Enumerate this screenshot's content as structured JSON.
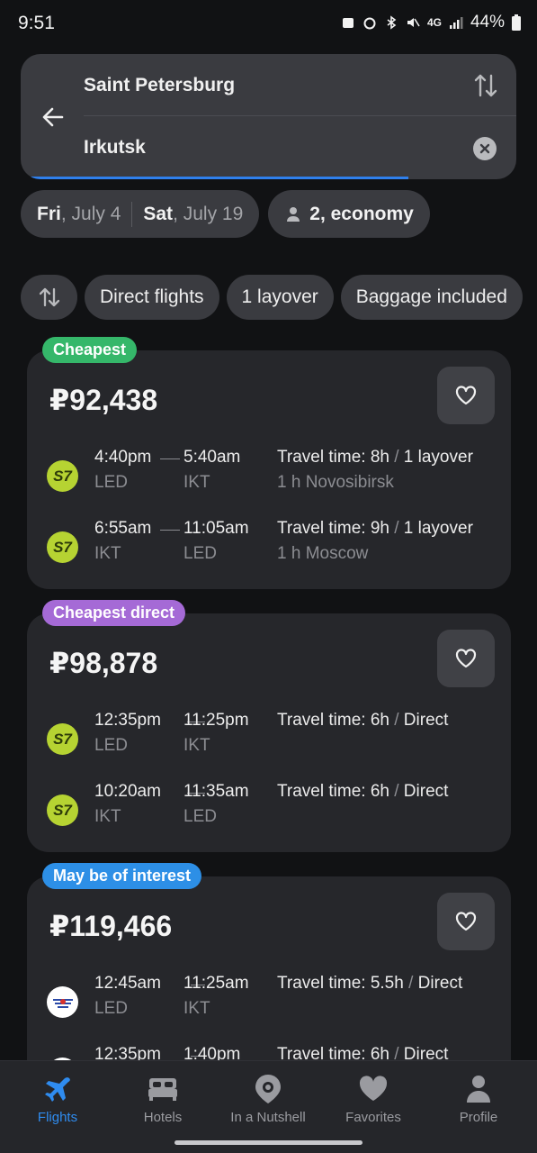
{
  "status": {
    "time": "9:51",
    "network": "4G",
    "battery": "44%"
  },
  "search": {
    "from": "Saint Petersburg",
    "to": "Irkutsk",
    "depart_day": "Fri",
    "depart_date": ", July 4",
    "return_day": "Sat",
    "return_date": ", July 19",
    "passengers": "2, economy"
  },
  "filters": [
    {
      "label": "Direct flights"
    },
    {
      "label": "1 layover"
    },
    {
      "label": "Baggage included"
    }
  ],
  "results": [
    {
      "badge": "Cheapest",
      "badge_color": "#35b76a",
      "price": "₽92,438",
      "legs": [
        {
          "airline": "S7",
          "dep_time": "4:40pm",
          "arr_time": "5:40am",
          "dep_code": "LED",
          "arr_code": "IKT",
          "travel": "Travel time: 8h",
          "stops": "1 layover",
          "via": "1 h Novosibirsk"
        },
        {
          "airline": "S7",
          "dep_time": "6:55am",
          "arr_time": "11:05am",
          "dep_code": "IKT",
          "arr_code": "LED",
          "travel": "Travel time: 9h",
          "stops": "1 layover",
          "via": "1 h Moscow"
        }
      ]
    },
    {
      "badge": "Cheapest direct",
      "badge_color": "#a56ad6",
      "price": "₽98,878",
      "legs": [
        {
          "airline": "S7",
          "dep_time": "12:35pm",
          "arr_time": "11:25pm",
          "dep_code": "LED",
          "arr_code": "IKT",
          "travel": "Travel time: 6h",
          "stops": "Direct",
          "via": ""
        },
        {
          "airline": "S7",
          "dep_time": "10:20am",
          "arr_time": "11:35am",
          "dep_code": "IKT",
          "arr_code": "LED",
          "travel": "Travel time: 6h",
          "stops": "Direct",
          "via": ""
        }
      ]
    },
    {
      "badge": "May be of interest",
      "badge_color": "#2d8fe6",
      "price": "₽119,466",
      "legs": [
        {
          "airline": "Aeroflot",
          "dep_time": "12:45am",
          "arr_time": "11:25am",
          "dep_code": "LED",
          "arr_code": "IKT",
          "travel": "Travel time: 5.5h",
          "stops": "Direct",
          "via": ""
        },
        {
          "airline": "Aeroflot",
          "dep_time": "12:35pm",
          "arr_time": "1:40pm",
          "dep_code": "",
          "arr_code": "",
          "travel": "Travel time: 6h",
          "stops": "Direct",
          "via": ""
        }
      ]
    }
  ],
  "nav": [
    {
      "label": "Flights",
      "icon": "airplane-icon",
      "active": true
    },
    {
      "label": "Hotels",
      "icon": "bed-icon",
      "active": false
    },
    {
      "label": "In a Nutshell",
      "icon": "camera-icon",
      "active": false
    },
    {
      "label": "Favorites",
      "icon": "heart-icon",
      "active": false
    },
    {
      "label": "Profile",
      "icon": "person-icon",
      "active": false
    }
  ],
  "colors": {
    "accent": "#2f80ed",
    "s7": "#b6d332"
  }
}
